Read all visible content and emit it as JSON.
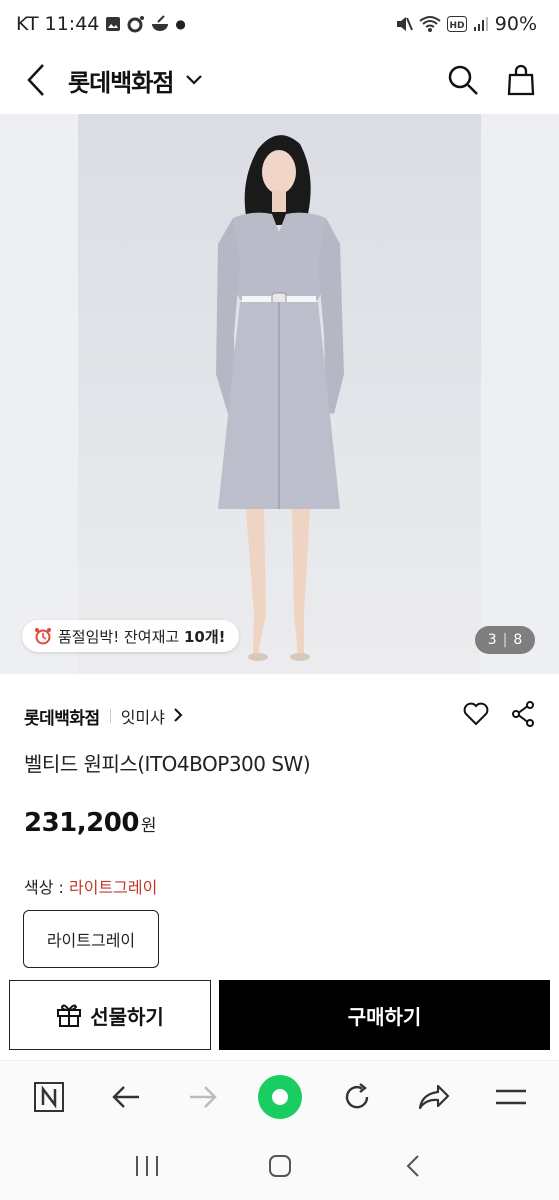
{
  "status_bar": {
    "carrier_time": "KT 11:44",
    "battery": "90%"
  },
  "header": {
    "title": "롯데백화점"
  },
  "product_image": {
    "stock_notice_prefix": "품절임박! 잔여재고 ",
    "stock_notice_count": "10개!",
    "page_current": "3",
    "page_total": "8"
  },
  "product": {
    "brand": "롯데백화점",
    "sub_brand": "잇미샤",
    "name": "벨티드 원피스(ITO4BOP300 SW)",
    "price": "231,200",
    "price_unit": "원",
    "color_label": "색상 : ",
    "color_value": "라이트그레이",
    "options": [
      "라이트그레이"
    ]
  },
  "actions": {
    "gift_label": "선물하기",
    "buy_label": "구매하기"
  },
  "colors": {
    "accent_red": "#c0392b",
    "buy_button": "#000000",
    "naver_green": "#19ce60"
  }
}
